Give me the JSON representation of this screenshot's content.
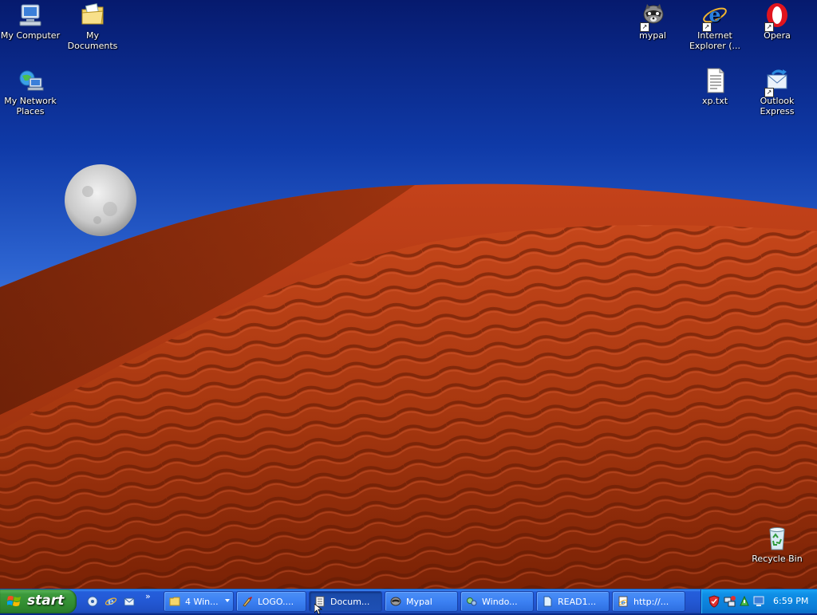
{
  "desktop": {
    "icons": [
      {
        "label": "My Computer"
      },
      {
        "label": "My Documents"
      },
      {
        "label": "My Network Places"
      },
      {
        "label": "mypal"
      },
      {
        "label": "Internet Explorer (..."
      },
      {
        "label": "Opera"
      },
      {
        "label": "xp.txt"
      },
      {
        "label": "Outlook Express"
      },
      {
        "label": "Recycle Bin"
      }
    ]
  },
  "taskbar": {
    "start_label": "start",
    "quicklaunch_more": "»",
    "tasks": [
      {
        "label": "4 Win..."
      },
      {
        "label": "LOGO...."
      },
      {
        "label": "Docum..."
      },
      {
        "label": "Mypal"
      },
      {
        "label": "Windo..."
      },
      {
        "label": "READ1..."
      },
      {
        "label": "http://..."
      }
    ],
    "clock": "6:59 PM"
  },
  "colors": {
    "sky_top": "#061a6e",
    "sky_bottom": "#6aa2f0",
    "dune": "#b5380f",
    "taskbar_blue": "#245edb",
    "start_green": "#3c9a3c",
    "tray_blue": "#0f8fe6"
  }
}
